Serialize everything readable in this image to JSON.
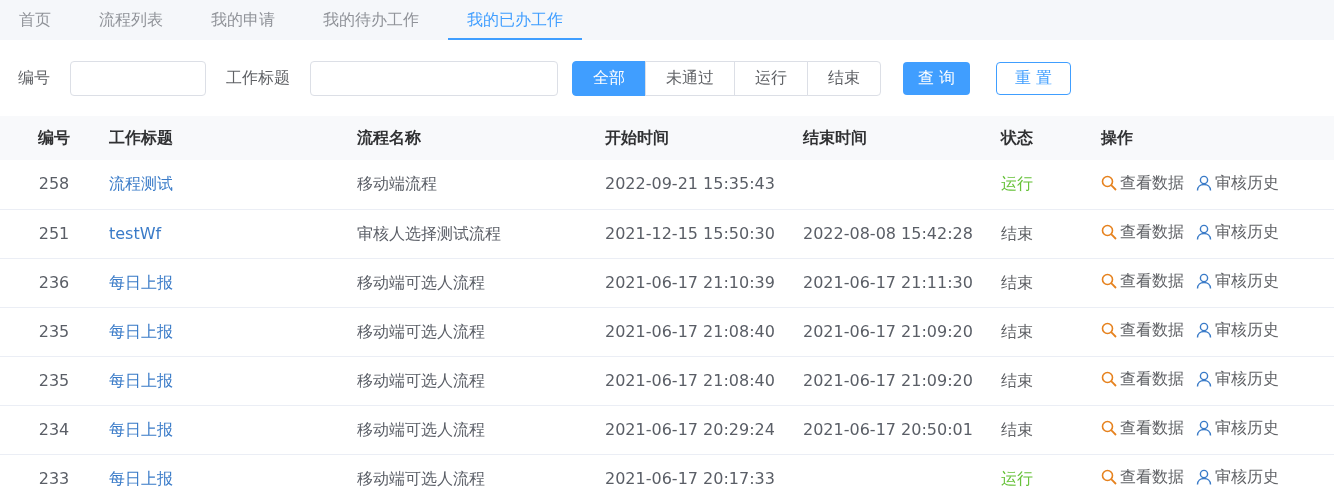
{
  "tabs": [
    {
      "label": "首页",
      "selected": false
    },
    {
      "label": "流程列表",
      "selected": false
    },
    {
      "label": "我的申请",
      "selected": false
    },
    {
      "label": "我的待办工作",
      "selected": false
    },
    {
      "label": "我的已办工作",
      "selected": true
    }
  ],
  "filters": {
    "fields": [
      {
        "label": "编号"
      },
      {
        "label": "工作标题"
      }
    ],
    "segments": [
      {
        "label": "全部",
        "selected": true
      },
      {
        "label": "未通过",
        "selected": false
      },
      {
        "label": "运行",
        "selected": false
      },
      {
        "label": "结束",
        "selected": false
      }
    ],
    "query_button": "查 询",
    "reset_button": "重 置"
  },
  "table": {
    "columns": [
      "编号",
      "工作标题",
      "流程名称",
      "开始时间",
      "结束时间",
      "状态",
      "操作"
    ],
    "rows": [
      {
        "id": "258",
        "title": "流程测试",
        "flow": "移动端流程",
        "start": "2022-09-21 15:35:43",
        "end": "",
        "status": {
          "text": "运行",
          "kind": "running"
        },
        "actions": [
          "查看数据",
          "审核历史"
        ]
      },
      {
        "id": "251",
        "title": "testWf",
        "flow": "审核人选择测试流程",
        "start": "2021-12-15 15:50:30",
        "end": "2022-08-08 15:42:28",
        "status": {
          "text": "结束",
          "kind": "ended"
        },
        "actions": [
          "查看数据",
          "审核历史"
        ]
      },
      {
        "id": "236",
        "title": "每日上报",
        "flow": "移动端可选人流程",
        "start": "2021-06-17 21:10:39",
        "end": "2021-06-17 21:11:30",
        "status": {
          "text": "结束",
          "kind": "ended"
        },
        "actions": [
          "查看数据",
          "审核历史"
        ]
      },
      {
        "id": "235",
        "title": "每日上报",
        "flow": "移动端可选人流程",
        "start": "2021-06-17 21:08:40",
        "end": "2021-06-17 21:09:20",
        "status": {
          "text": "结束",
          "kind": "ended"
        },
        "actions": [
          "查看数据",
          "审核历史"
        ]
      },
      {
        "id": "235",
        "title": "每日上报",
        "flow": "移动端可选人流程",
        "start": "2021-06-17 21:08:40",
        "end": "2021-06-17 21:09:20",
        "status": {
          "text": "结束",
          "kind": "ended"
        },
        "actions": [
          "查看数据",
          "审核历史"
        ]
      },
      {
        "id": "234",
        "title": "每日上报",
        "flow": "移动端可选人流程",
        "start": "2021-06-17 20:29:24",
        "end": "2021-06-17 20:50:01",
        "status": {
          "text": "结束",
          "kind": "ended"
        },
        "actions": [
          "查看数据",
          "审核历史"
        ]
      },
      {
        "id": "233",
        "title": "每日上报",
        "flow": "移动端可选人流程",
        "start": "2021-06-17 20:17:33",
        "end": "",
        "status": {
          "text": "运行",
          "kind": "running"
        },
        "actions": [
          "查看数据",
          "审核历史"
        ]
      }
    ]
  }
}
